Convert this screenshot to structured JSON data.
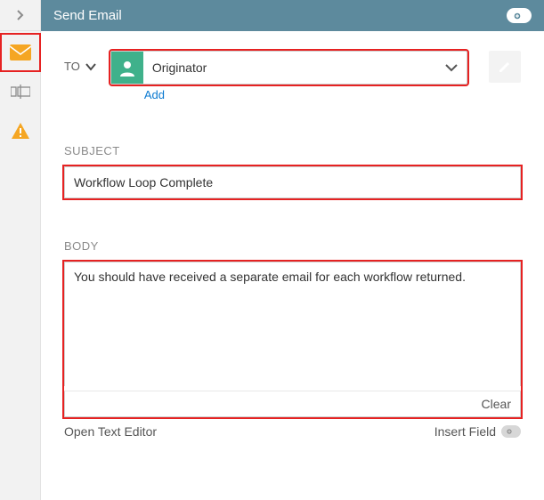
{
  "header": {
    "title": "Send Email"
  },
  "to": {
    "label": "TO",
    "value": "Originator",
    "add_label": "Add"
  },
  "subject": {
    "label": "SUBJECT",
    "value": "Workflow Loop Complete"
  },
  "body": {
    "label": "BODY",
    "value": "You should have received a separate email for each workflow returned.",
    "clear_label": "Clear"
  },
  "footer": {
    "open_editor": "Open Text Editor",
    "insert_field": "Insert Field"
  }
}
